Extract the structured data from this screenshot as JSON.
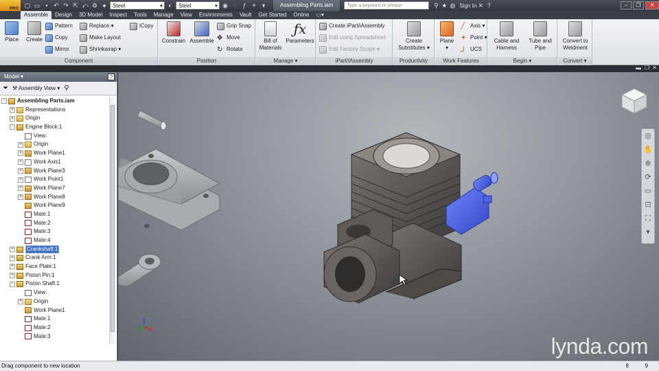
{
  "titlebar": {
    "material_1": "Steel",
    "material_2": "Steel",
    "document_tab": "Assembling Parts.iam",
    "search_placeholder": "Type a keyword or phrase",
    "sign_in": "Sign In",
    "logo_badge": "PRO"
  },
  "menu_tabs": [
    "Assemble",
    "Design",
    "3D Model",
    "Inspect",
    "Tools",
    "Manage",
    "View",
    "Environments",
    "Vault",
    "Get Started",
    "Online"
  ],
  "ribbon": {
    "component": {
      "title": "Component",
      "place": "Place",
      "create": "Create",
      "pattern": "Pattern",
      "copy": "Copy",
      "mirror": "Mirror",
      "replace": "Replace",
      "make_layout": "Make Layout",
      "shrinkwrap": "Shrinkwrap",
      "icopy": "iCopy"
    },
    "position": {
      "title": "Position",
      "constrain": "Constrain",
      "assemble": "Assemble",
      "grip_snap": "Grip Snap",
      "move": "Move",
      "rotate": "Rotate"
    },
    "manage": {
      "title": "Manage",
      "bill_of_materials": [
        "Bill of",
        "Materials"
      ],
      "parameters": "Parameters"
    },
    "ipart": {
      "title": "iPart/iAssembly",
      "create": "Create iPart/iAssembly",
      "edit_spreadsheet": "Edit using Spreadsheet",
      "edit_scope": "Edit Factory Scope"
    },
    "productivity": {
      "title": "Productivity",
      "create_substitutes": [
        "Create",
        "Substitutes"
      ]
    },
    "work_features": {
      "title": "Work Features",
      "plane": "Plane",
      "axis": "Axis",
      "point": "Point",
      "ucs": "UCS"
    },
    "begin": {
      "title": "Begin",
      "cable": [
        "Cable and",
        "Harness"
      ],
      "tube": [
        "Tube and",
        "Pipe"
      ]
    },
    "convert": {
      "title": "Convert",
      "weldment": [
        "Convert to",
        "Weldment"
      ]
    }
  },
  "browser": {
    "header": "Model",
    "help": "?",
    "view_selector": "Assembly View",
    "nodes": [
      {
        "indent": 0,
        "exp": "-",
        "icon": "nasm",
        "label": "Assembling Parts.iam",
        "bold": true
      },
      {
        "indent": 1,
        "exp": "+",
        "icon": "nfold",
        "label": "Representations"
      },
      {
        "indent": 1,
        "exp": "+",
        "icon": "nfold",
        "label": "Origin"
      },
      {
        "indent": 1,
        "exp": "-",
        "icon": "nasm",
        "label": "Engine Block:1"
      },
      {
        "indent": 2,
        "exp": "",
        "icon": "nview",
        "label": "View:"
      },
      {
        "indent": 2,
        "exp": "+",
        "icon": "nfold",
        "label": "Origin"
      },
      {
        "indent": 2,
        "exp": "+",
        "icon": "nplane",
        "label": "Work Plane1"
      },
      {
        "indent": 2,
        "exp": "+",
        "icon": "naxis",
        "label": "Work Axis1"
      },
      {
        "indent": 2,
        "exp": "+",
        "icon": "nplane",
        "label": "Work Plane3"
      },
      {
        "indent": 2,
        "exp": "+",
        "icon": "naxis",
        "label": "Work Point1"
      },
      {
        "indent": 2,
        "exp": "+",
        "icon": "nplane",
        "label": "Work Plane7"
      },
      {
        "indent": 2,
        "exp": "+",
        "icon": "nplane",
        "label": "Work Plane8"
      },
      {
        "indent": 2,
        "exp": "",
        "icon": "nplane",
        "label": "Work Plane9"
      },
      {
        "indent": 2,
        "exp": "",
        "icon": "nmate",
        "label": "Mate:1"
      },
      {
        "indent": 2,
        "exp": "",
        "icon": "nmate",
        "label": "Mate:2"
      },
      {
        "indent": 2,
        "exp": "",
        "icon": "nmate",
        "label": "Mate:3"
      },
      {
        "indent": 2,
        "exp": "",
        "icon": "nmate",
        "label": "Mate:4"
      },
      {
        "indent": 1,
        "exp": "+",
        "icon": "nasm",
        "label": "Crankshaft:1",
        "selected": true
      },
      {
        "indent": 1,
        "exp": "+",
        "icon": "nasm",
        "label": "Crank Arm:1"
      },
      {
        "indent": 1,
        "exp": "+",
        "icon": "nasm",
        "label": "Face Plate:1"
      },
      {
        "indent": 1,
        "exp": "+",
        "icon": "nasm",
        "label": "Piston Pin:1"
      },
      {
        "indent": 1,
        "exp": "-",
        "icon": "nasm",
        "label": "Piston Shaft:1"
      },
      {
        "indent": 2,
        "exp": "",
        "icon": "nview",
        "label": "View:"
      },
      {
        "indent": 2,
        "exp": "+",
        "icon": "nfold",
        "label": "Origin"
      },
      {
        "indent": 2,
        "exp": "",
        "icon": "nplane",
        "label": "Work Plane1"
      },
      {
        "indent": 2,
        "exp": "",
        "icon": "nmate",
        "label": "Mate:1"
      },
      {
        "indent": 2,
        "exp": "",
        "icon": "nmate",
        "label": "Mate:2"
      },
      {
        "indent": 2,
        "exp": "",
        "icon": "nmate",
        "label": "Mate:3"
      }
    ]
  },
  "viewport": {
    "watermark": "lynda.com"
  },
  "status": {
    "message": "Drag component to new location",
    "count_1": "8",
    "count_2": "9"
  },
  "colors": {
    "selected_part": "#3c5ed8",
    "highlight": "#3b6fc4"
  }
}
